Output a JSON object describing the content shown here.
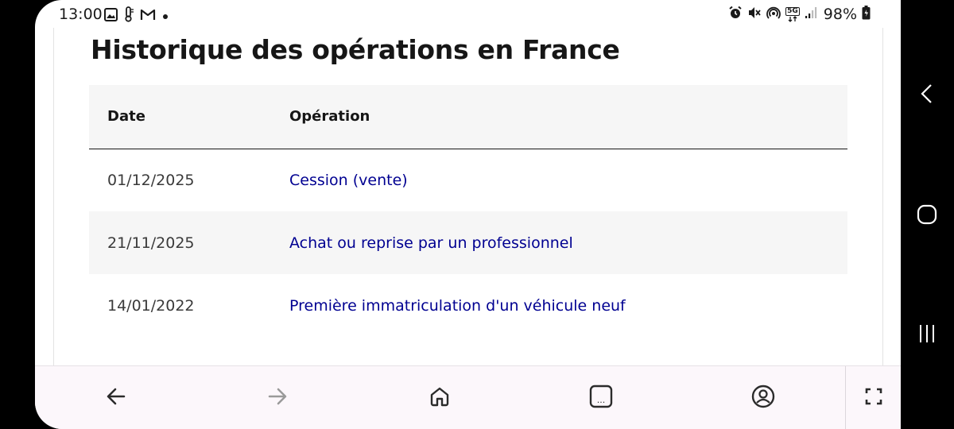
{
  "status_bar": {
    "time": "13:00",
    "left_icons": [
      "image-icon",
      "thermometer-icon",
      "gmail-icon",
      "dot-icon"
    ],
    "right_icons": [
      "alarm-icon",
      "mute-icon",
      "hotspot-icon",
      "5g-icon",
      "signal-icon"
    ],
    "network_badge": "5G",
    "battery": "98%"
  },
  "page": {
    "title": "Historique des opérations en France",
    "table": {
      "headers": [
        "Date",
        "Opération"
      ],
      "rows": [
        {
          "date": "01/12/2025",
          "operation": "Cession (vente)"
        },
        {
          "date": "21/11/2025",
          "operation": "Achat ou reprise par un professionnel"
        },
        {
          "date": "14/01/2022",
          "operation": "Première immatriculation d'un véhicule neuf"
        }
      ]
    }
  },
  "bottom_nav": {
    "buttons": [
      "back-icon",
      "forward-icon",
      "home-icon",
      "tabs-icon",
      "account-icon",
      "fullscreen-icon"
    ],
    "tabs_label": "..."
  },
  "system_nav": {
    "buttons": [
      "system-back-icon",
      "system-home-icon",
      "system-recents-icon"
    ]
  },
  "colors": {
    "link": "#000091",
    "header_bg": "#f6f6f6",
    "nav_bg": "#fcf7fb"
  }
}
